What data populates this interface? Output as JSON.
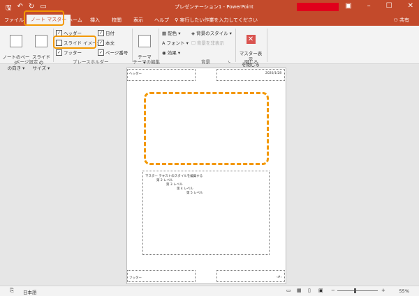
{
  "titlebar": {
    "title": "プレゼンテーション1  -  PowerPoint",
    "qat": {
      "save": "🖫",
      "undo": "↶",
      "redo": "↻",
      "custom": "▭"
    },
    "window": {
      "min": "–",
      "max": "☐",
      "close": "✕",
      "ribbon": "▣"
    }
  },
  "tabs": {
    "file": "ファイル",
    "notes_master": "ノート マスター",
    "home": "ホーム",
    "insert": "挿入",
    "review": "校閲",
    "view": "表示",
    "help": "ヘルプ",
    "tellme": "実行したい作業を入力してください",
    "share": "共有"
  },
  "ribbon": {
    "orientation": "ノートのページ\nの向き ▾",
    "slide_size": "スライドの\nサイズ ▾",
    "page_setup_group": "ページ設定",
    "header": "ヘッダー",
    "date": "日付",
    "slide_image": "スライド イメージ",
    "body": "本文",
    "footer": "フッター",
    "page_number": "ページ番号",
    "placeholders_group": "プレースホルダー",
    "theme": "テーマ\n▾",
    "edit_theme_group": "テーマの編集",
    "colors": "配色 ▾",
    "fonts": "フォント ▾",
    "effects": "効果 ▾",
    "bg_styles": "背景のスタイル ▾",
    "hide_bg": "背景を非表示",
    "background_group": "背景",
    "close_master": "マスター表示\nを閉じる",
    "close_group": "閉じる"
  },
  "page": {
    "header": "ヘッダー",
    "date": "2020/1/28",
    "notes": [
      "マスター テキストのスタイルを編集する",
      "第 2 レベル",
      "第 3 レベル",
      "第 4 レベル",
      "第 5 レベル"
    ],
    "footer": "フッター",
    "page_num": "‹#›"
  },
  "status": {
    "language": "日本語",
    "zoom": "55%"
  },
  "colors": {
    "accent": "#c34a2b",
    "highlight": "#f39800"
  }
}
